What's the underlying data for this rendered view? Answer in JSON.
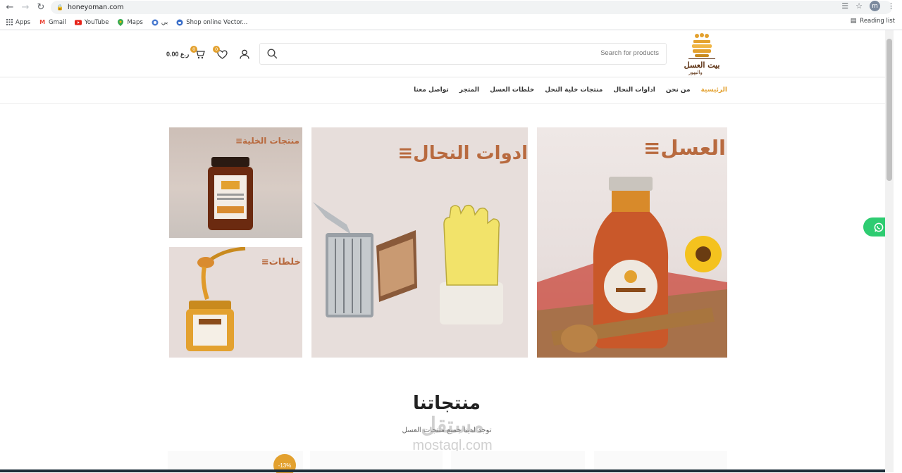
{
  "browser": {
    "url": "honeyoman.com",
    "avatar_letter": "m",
    "bookmarks": [
      {
        "label": "Apps",
        "icon": "apps-grid-icon"
      },
      {
        "label": "Gmail",
        "icon": "gmail-icon"
      },
      {
        "label": "YouTube",
        "icon": "youtube-icon"
      },
      {
        "label": "Maps",
        "icon": "maps-pin-icon"
      },
      {
        "label": "بي",
        "icon": "bee-icon"
      },
      {
        "label": "Shop online Vector...",
        "icon": "shop-icon"
      }
    ],
    "reading_list": "Reading list"
  },
  "header": {
    "logo_name": "بيت العسل",
    "logo_sub": "والبهور",
    "search_placeholder": "Search for products",
    "cart_total": "0.00 ر.ع",
    "cart_count": "0",
    "wishlist_count": "0"
  },
  "nav": {
    "items": [
      {
        "label": "الرئيسية",
        "active": true
      },
      {
        "label": "من نحن"
      },
      {
        "label": "اداوات النحال"
      },
      {
        "label": "منتجات خلية النحل"
      },
      {
        "label": "خلطات العسل"
      },
      {
        "label": "المتجر"
      },
      {
        "label": "تواصل معنا"
      }
    ]
  },
  "tiles": {
    "cells": "منتجات الخلية",
    "mixes": "خلطات",
    "tools": "ادوات النحال",
    "honey": "العسل"
  },
  "section": {
    "title": "منتجاتنا",
    "subtitle": "توجد لدينا جميع منتجات العسل"
  },
  "products": {
    "sale_badge": "-13%"
  },
  "watermark": {
    "arabic": "مستقل",
    "latin": "mostaql.com"
  },
  "colors": {
    "accent": "#e3a12f",
    "tile_text": "#b86a3f",
    "whatsapp": "#2ecc71"
  }
}
